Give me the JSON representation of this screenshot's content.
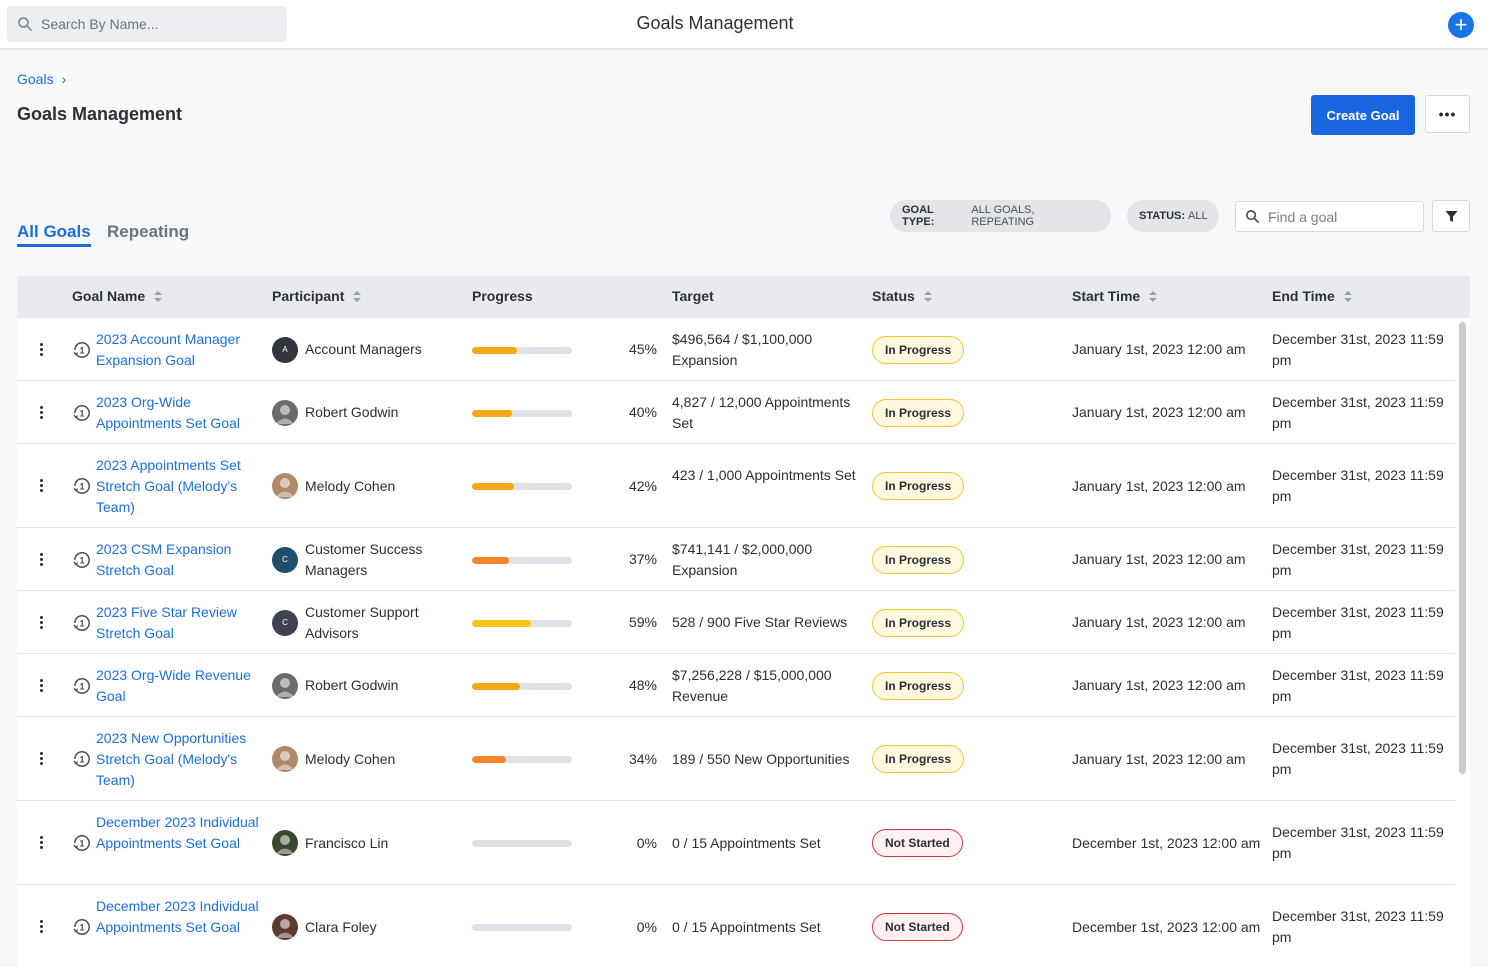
{
  "topbar": {
    "search_placeholder": "Search By Name...",
    "title": "Goals Management",
    "add_label": "+"
  },
  "breadcrumb": {
    "root": "Goals",
    "separator": "›"
  },
  "page": {
    "title": "Goals Management",
    "create_label": "Create Goal",
    "more_label": "•••"
  },
  "tabs": [
    {
      "label": "All Goals",
      "active": true
    },
    {
      "label": "Repeating",
      "active": false
    }
  ],
  "filters": {
    "goal_type_key": "GOAL TYPE:",
    "goal_type_value": "ALL GOALS, REPEATING",
    "status_key": "STATUS:",
    "status_value": "ALL",
    "find_placeholder": "Find a goal"
  },
  "columns": [
    "Goal Name",
    "Participant",
    "Progress",
    "Target",
    "Status",
    "Start Time",
    "End Time"
  ],
  "colors": {
    "accent": "#1a66e0",
    "link": "#1a6fdb",
    "bar_amber": "#f5a816",
    "bar_orange": "#f5862b",
    "bar_yellow": "#f7c518",
    "in_progress_border": "#f4c430",
    "not_started_border": "#d63544"
  },
  "rows": [
    {
      "name": "2023 Account Manager Expansion Goal",
      "participant": "Account Managers",
      "avatar_initial": "A",
      "avatar_color": "#2f3640",
      "progress": 0.45,
      "progress_label": "45%",
      "bar_color": "#f5a816",
      "target": "$496,564 / $1,100,000 Expansion",
      "status": "In Progress",
      "status_kind": "progress",
      "start": "January 1st, 2023 12:00 am",
      "end": "December 31st, 2023 11:59 pm"
    },
    {
      "name": "2023 Org-Wide Appointments Set Goal",
      "participant": "Robert Godwin",
      "avatar_initial": "",
      "avatar_color": "#6b6b6b",
      "progress": 0.4,
      "progress_label": "40%",
      "bar_color": "#f5a816",
      "target": "4,827 / 12,000 Appointments Set",
      "status": "In Progress",
      "status_kind": "progress",
      "start": "January 1st, 2023 12:00 am",
      "end": "December 31st, 2023 11:59 pm"
    },
    {
      "name": "2023 Appointments Set Stretch Goal (Melody's Team)",
      "participant": "Melody Cohen",
      "avatar_initial": "",
      "avatar_color": "#b08968",
      "progress": 0.42,
      "progress_label": "42%",
      "bar_color": "#f5a816",
      "target": "423 / 1,000 Appointments Set",
      "status": "In Progress",
      "status_kind": "progress",
      "start": "January 1st, 2023 12:00 am",
      "end": "December 31st, 2023 11:59 pm"
    },
    {
      "name": "2023 CSM Expansion Stretch Goal",
      "participant": "Customer Success Managers",
      "avatar_initial": "C",
      "avatar_color": "#1f4e6b",
      "progress": 0.37,
      "progress_label": "37%",
      "bar_color": "#f5862b",
      "target": "$741,141 / $2,000,000 Expansion",
      "status": "In Progress",
      "status_kind": "progress",
      "start": "January 1st, 2023 12:00 am",
      "end": "December 31st, 2023 11:59 pm"
    },
    {
      "name": "2023 Five Star Review Stretch Goal",
      "participant": "Customer Support Advisors",
      "avatar_initial": "C",
      "avatar_color": "#3d4450",
      "progress": 0.59,
      "progress_label": "59%",
      "bar_color": "#f7c518",
      "target": "528 / 900 Five Star Reviews",
      "status": "In Progress",
      "status_kind": "progress",
      "start": "January 1st, 2023 12:00 am",
      "end": "December 31st, 2023 11:59 pm"
    },
    {
      "name": "2023 Org-Wide Revenue Goal",
      "participant": "Robert Godwin",
      "avatar_initial": "",
      "avatar_color": "#6b6b6b",
      "progress": 0.48,
      "progress_label": "48%",
      "bar_color": "#f5a816",
      "target": "$7,256,228 / $15,000,000 Revenue",
      "status": "In Progress",
      "status_kind": "progress",
      "start": "January 1st, 2023 12:00 am",
      "end": "December 31st, 2023 11:59 pm"
    },
    {
      "name": "2023 New Opportunities Stretch Goal (Melody's Team)",
      "participant": "Melody Cohen",
      "avatar_initial": "",
      "avatar_color": "#b08968",
      "progress": 0.34,
      "progress_label": "34%",
      "bar_color": "#f5862b",
      "target": "189 / 550 New Opportunities",
      "status": "In Progress",
      "status_kind": "progress",
      "start": "January 1st, 2023 12:00 am",
      "end": "December 31st, 2023 11:59 pm"
    },
    {
      "name": "December 2023 Individual Appointments Set Goal",
      "participant": "Francisco Lin",
      "avatar_initial": "",
      "avatar_color": "#3b4a2f",
      "progress": 0,
      "progress_label": "0%",
      "bar_color": "#f5a816",
      "target": "0 / 15 Appointments Set",
      "status": "Not Started",
      "status_kind": "notstarted",
      "start": "December 1st, 2023 12:00 am",
      "end": "December 31st, 2023 11:59 pm"
    },
    {
      "name": "December 2023 Individual Appointments Set Goal",
      "participant": "Clara Foley",
      "avatar_initial": "",
      "avatar_color": "#5a3b2e",
      "progress": 0,
      "progress_label": "0%",
      "bar_color": "#f5a816",
      "target": "0 / 15 Appointments Set",
      "status": "Not Started",
      "status_kind": "notstarted",
      "start": "December 1st, 2023 12:00 am",
      "end": "December 31st, 2023 11:59 pm"
    }
  ]
}
